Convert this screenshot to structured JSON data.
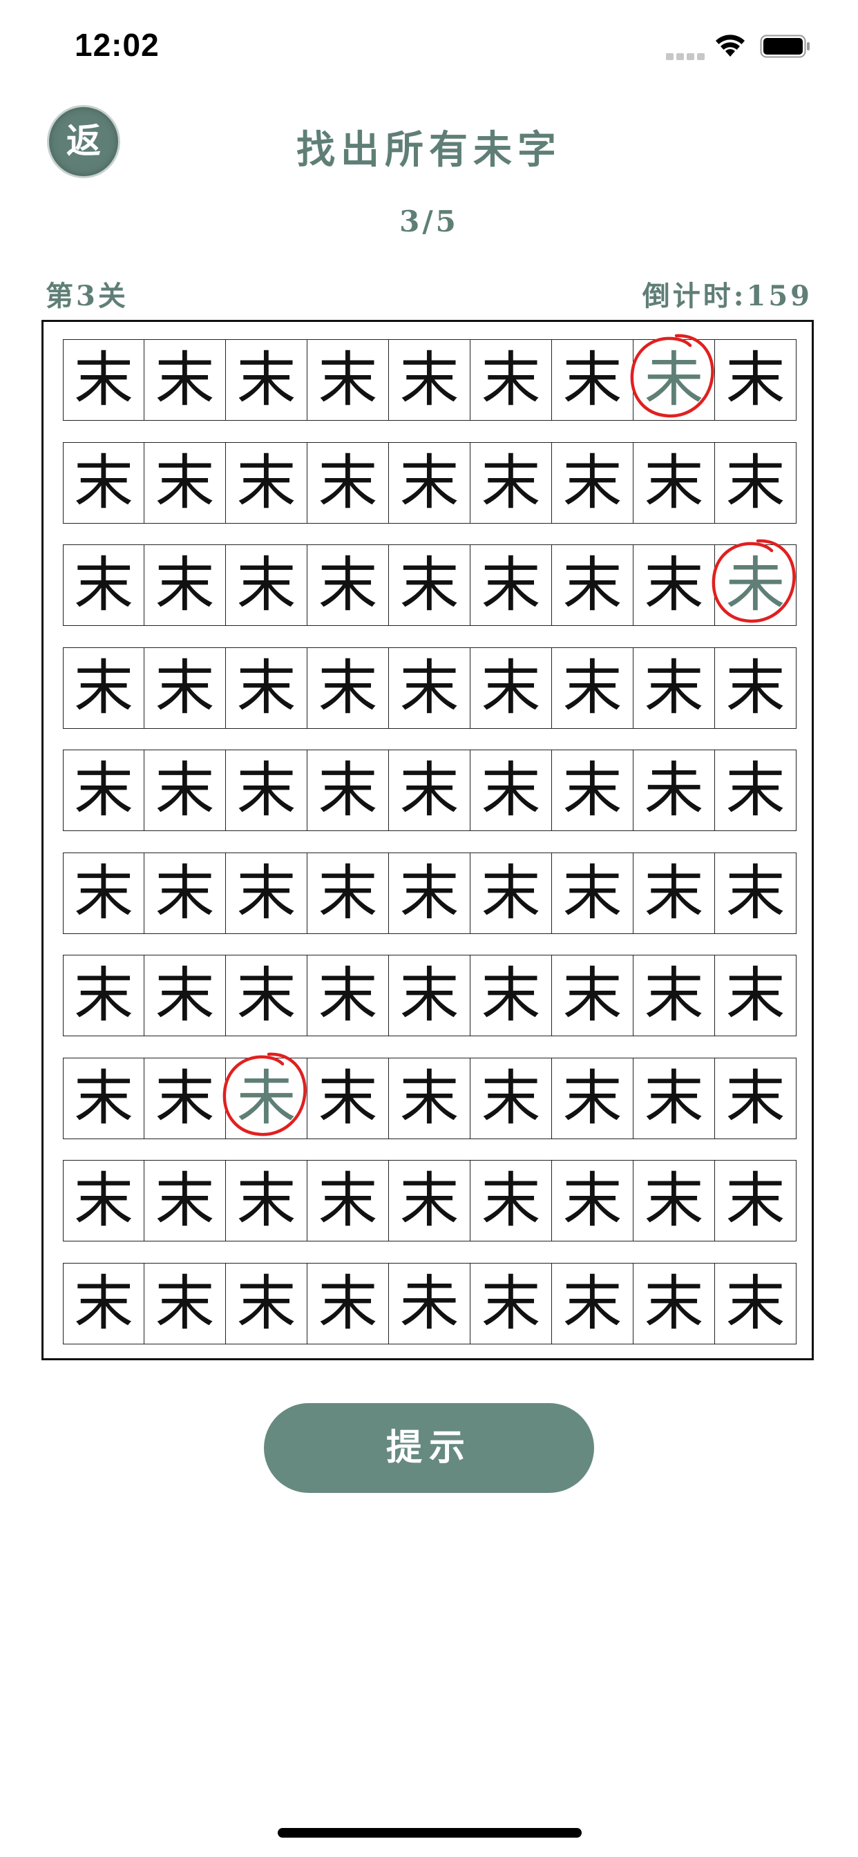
{
  "status_bar": {
    "time": "12:02"
  },
  "header": {
    "back_label": "返",
    "title": "找出所有未字",
    "progress": "3/5"
  },
  "level": {
    "label": "第3关",
    "countdown_label": "倒计时:",
    "countdown_value": "159"
  },
  "board": {
    "rows": 10,
    "cols": 9,
    "base_char": "末",
    "target_char": "未",
    "cells": [
      [
        "末",
        "末",
        "末",
        "末",
        "末",
        "末",
        "末",
        "未",
        "末"
      ],
      [
        "末",
        "末",
        "末",
        "末",
        "末",
        "末",
        "末",
        "末",
        "末"
      ],
      [
        "末",
        "末",
        "末",
        "末",
        "末",
        "末",
        "末",
        "末",
        "未"
      ],
      [
        "末",
        "末",
        "末",
        "末",
        "末",
        "末",
        "末",
        "末",
        "末"
      ],
      [
        "末",
        "末",
        "末",
        "末",
        "末",
        "末",
        "末",
        "未",
        "末"
      ],
      [
        "末",
        "末",
        "末",
        "末",
        "末",
        "末",
        "末",
        "末",
        "末"
      ],
      [
        "末",
        "末",
        "末",
        "末",
        "末",
        "末",
        "末",
        "末",
        "末"
      ],
      [
        "末",
        "末",
        "未",
        "末",
        "末",
        "末",
        "末",
        "末",
        "末"
      ],
      [
        "末",
        "末",
        "末",
        "末",
        "末",
        "末",
        "末",
        "末",
        "末"
      ],
      [
        "末",
        "末",
        "末",
        "末",
        "未",
        "末",
        "末",
        "末",
        "末"
      ]
    ],
    "found": [
      {
        "row": 0,
        "col": 7
      },
      {
        "row": 2,
        "col": 8
      },
      {
        "row": 7,
        "col": 2
      }
    ],
    "found_color": "#5f7f76",
    "circle_color": "#e02020"
  },
  "hint_button": {
    "label": "提示"
  },
  "colors": {
    "accent": "#5f7f76",
    "button": "#678a80"
  }
}
